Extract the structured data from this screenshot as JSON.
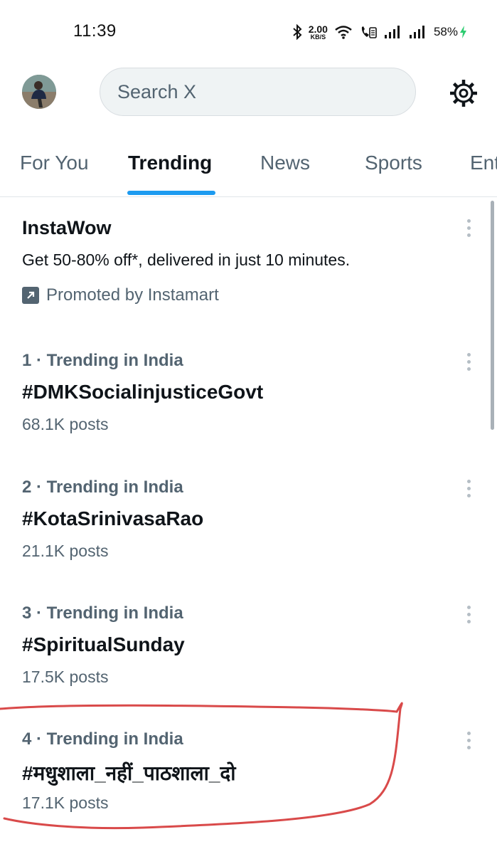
{
  "status_bar": {
    "time": "11:39",
    "net_speed_value": "2.00",
    "net_speed_unit": "KB/S",
    "battery": "58%",
    "icons": [
      "bluetooth-icon",
      "wifi-icon",
      "call-icon",
      "signal-icon",
      "signal-icon",
      "charging-icon"
    ]
  },
  "header": {
    "search_placeholder": "Search X",
    "settings_icon": "gear-icon"
  },
  "tabs": [
    {
      "label": "For You",
      "active": false
    },
    {
      "label": "Trending",
      "active": true
    },
    {
      "label": "News",
      "active": false
    },
    {
      "label": "Sports",
      "active": false
    },
    {
      "label": "Ent",
      "active": false
    }
  ],
  "promoted": {
    "title": "InstaWow",
    "description": "Get 50-80% off*, delivered in just 10 minutes.",
    "promoted_by": "Promoted by Instamart"
  },
  "trends": [
    {
      "context": "1 · Trending in India",
      "topic": "#DMKSocialinjusticeGovt",
      "posts": "68.1K posts"
    },
    {
      "context": "2 · Trending in India",
      "topic": "#KotaSrinivasaRao",
      "posts": "21.1K posts"
    },
    {
      "context": "3 · Trending in India",
      "topic": "#SpiritualSunday",
      "posts": "17.5K posts"
    },
    {
      "context": "4 · Trending in India",
      "topic": "#मधुशाला_नहीं_पाठशाला_दो",
      "posts": "17.1K posts"
    }
  ],
  "colors": {
    "accent": "#1d9bf0",
    "primary_text": "#0f1419",
    "secondary_text": "#536471",
    "annotation": "#d94a4a"
  }
}
